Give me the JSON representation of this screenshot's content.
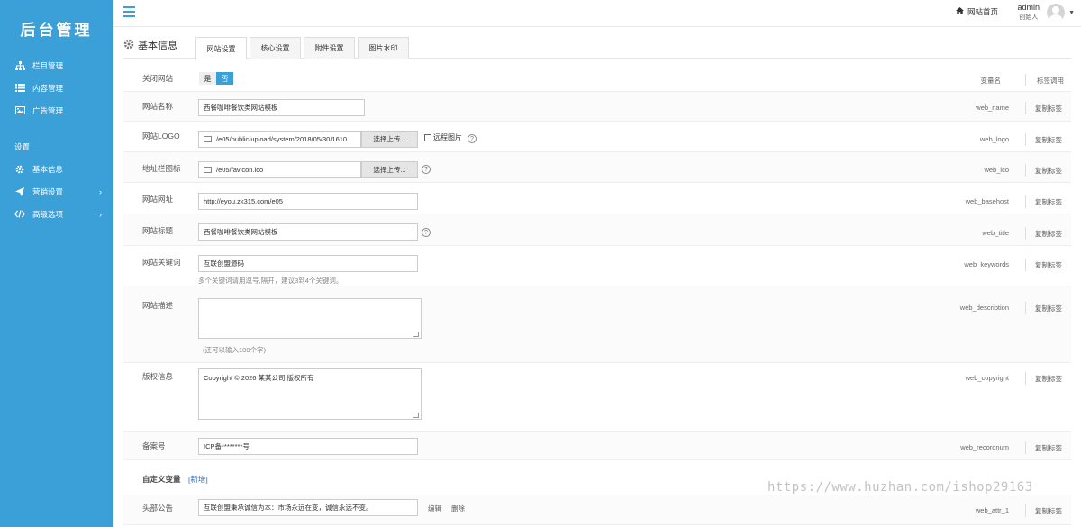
{
  "sidebar": {
    "title": "后台管理",
    "items": [
      {
        "label": "栏目管理",
        "icon": "sitemap-icon"
      },
      {
        "label": "内容管理",
        "icon": "list-icon"
      },
      {
        "label": "广告管理",
        "icon": "image-icon"
      }
    ],
    "section_label": "设置",
    "settings_items": [
      {
        "label": "基本信息",
        "icon": "gear-icon"
      },
      {
        "label": "营销设置",
        "icon": "send-icon"
      },
      {
        "label": "高级选项",
        "icon": "code-icon"
      }
    ]
  },
  "topbar": {
    "home_label": "网站首页",
    "user_name": "admin",
    "user_role": "创始人"
  },
  "page": {
    "title": "基本信息",
    "tabs": [
      "网站设置",
      "核心设置",
      "附件设置",
      "图片水印"
    ],
    "active_tab": 0,
    "col_var": "变量名",
    "col_tag": "标签调用",
    "copy_label": "复制标签"
  },
  "fields": {
    "close_site": {
      "label": "关闭网站",
      "yes": "是",
      "no": "否",
      "selected": "否"
    },
    "web_name": {
      "label": "网站名称",
      "value": "西餐咖啡餐饮类网站模板",
      "var": "web_name"
    },
    "web_logo": {
      "label": "网站LOGO",
      "value": "/e05/public/upload/system/2018/05/30/1610",
      "button": "选择上传...",
      "remote": "远程图片",
      "var": "web_logo"
    },
    "web_ico": {
      "label": "地址栏图标",
      "value": "/e05/favicon.ico",
      "button": "选择上传...",
      "var": "web_ico"
    },
    "web_basehost": {
      "label": "网站网址",
      "value": "http://eyou.zk315.com/e05",
      "var": "web_basehost"
    },
    "web_title": {
      "label": "网站标题",
      "value": "西餐咖啡餐饮类网站模板",
      "var": "web_title"
    },
    "web_keywords": {
      "label": "网站关键词",
      "value": "互联创盟源码",
      "hint": "多个关键词请用逗号,隔开，建议3到4个关键词。",
      "var": "web_keywords"
    },
    "web_description": {
      "label": "网站描述",
      "value": "",
      "hint": "(还可以输入100个字)",
      "var": "web_description"
    },
    "web_copyright": {
      "label": "版权信息",
      "value": "Copyright © 2026 某某公司 版权所有",
      "var": "web_copyright"
    },
    "web_recordnum": {
      "label": "备案号",
      "value": "ICP备********号",
      "var": "web_recordnum"
    },
    "custom": {
      "label": "自定义变量",
      "add_link": "[新增]"
    },
    "web_attr_1": {
      "label": "头部公告",
      "value": "互联创盟秉承诚信为本：市场永远在变，诚信永远不变。",
      "edit": "编辑",
      "delete": "删除",
      "var": "web_attr_1"
    }
  },
  "watermark": "https://www.huzhan.com/ishop29163",
  "colors": {
    "accent": "#3b9fd8"
  }
}
